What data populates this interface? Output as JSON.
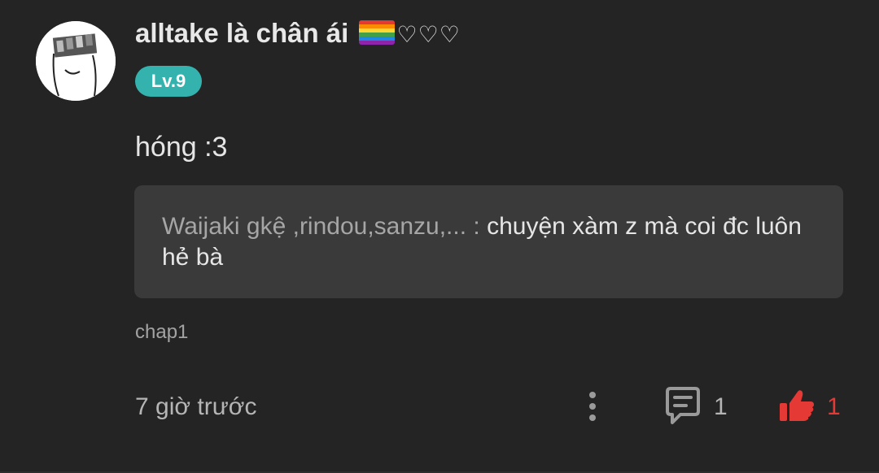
{
  "comment": {
    "username": "alltake là chân ái",
    "username_hearts": "♡♡♡",
    "level": "Lv.9",
    "text": "hóng :3",
    "quote": {
      "author": "Waijaki gkệ ,rindou,sanzu,... :",
      "body": " chuyện xàm z mà coi đc luôn hẻ bà"
    },
    "chapter": "chap1",
    "timestamp": "7 giờ trước",
    "reply_count": "1",
    "like_count": "1"
  },
  "colors": {
    "background": "#242424",
    "quote_background": "#3a3a3a",
    "badge": "#34b3ae",
    "like": "#e53935"
  },
  "icons": [
    "avatar",
    "rainbow-flag-icon",
    "more-vertical-icon",
    "reply-icon",
    "thumbs-up-icon"
  ]
}
